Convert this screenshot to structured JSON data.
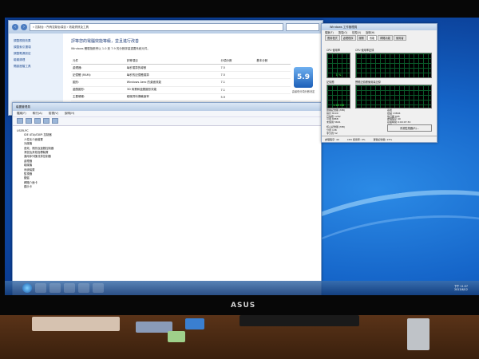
{
  "control_panel": {
    "address": "« 控制台 › 所有控制台項目 › 效能資訊及工具",
    "side_links": [
      "調整視覺效果",
      "調整索引選項",
      "調整電源設定",
      "磁碟清理",
      "開啟進階工具"
    ],
    "heading": "評等您的電腦效能等級，並且進行改善",
    "subtitle": "Windows 體驗指數會以 1.0 到 7.9 的分數評量重要系統元件。",
    "columns": [
      "元件",
      "評等項目",
      "分項分數",
      "基本分數"
    ],
    "rows": [
      {
        "component": "處理器:",
        "description": "每秒運算的導數",
        "score": "7.5"
      },
      {
        "component": "記憶體 (RAM):",
        "description": "每秒的記憶體運算",
        "score": "7.5"
      },
      {
        "component": "圖形:",
        "description": "Windows Aero 的桌面效能",
        "score": "7.1"
      },
      {
        "component": "遊戲圖形:",
        "description": "3D 商業和遊戲圖形效能",
        "score": "7.1"
      },
      {
        "component": "主要硬碟:",
        "description": "磁碟資料傳輸速率",
        "score": "5.9"
      }
    ],
    "base_score": "5.9",
    "base_caption": "由最低分項分數決定"
  },
  "device_manager": {
    "title": "裝置管理員",
    "menu": [
      "檔案(F)",
      "執行(A)",
      "檢視(V)",
      "說明(H)"
    ],
    "tree": [
      {
        "label": "USER-PC",
        "level": 0
      },
      {
        "label": "IDE ATA/ATAPI 控制器",
        "level": 1
      },
      {
        "label": "人性化介面裝置",
        "level": 1
      },
      {
        "label": "光碟機",
        "level": 1
      },
      {
        "label": "音效、視訊及遊戲控制器",
        "level": 1
      },
      {
        "label": "滑鼠及其他指標裝置",
        "level": 1
      },
      {
        "label": "通用序列匯流排控制器",
        "level": 1
      },
      {
        "label": "處理器",
        "level": 1
      },
      {
        "label": "磁碟機",
        "level": 1
      },
      {
        "label": "系統裝置",
        "level": 1
      },
      {
        "label": "監視器",
        "level": 1
      },
      {
        "label": "鍵盤",
        "level": 1
      },
      {
        "label": "網路介面卡",
        "level": 1
      },
      {
        "label": "顯示卡",
        "level": 1
      }
    ]
  },
  "task_manager": {
    "title": "Windows 工作管理員",
    "menu": [
      "檔案(F)",
      "選項(O)",
      "檢視(V)",
      "說明(H)"
    ],
    "tabs": [
      "應用程式",
      "處理程序",
      "服務",
      "效能",
      "網路功能",
      "使用者"
    ],
    "active_tab": "效能",
    "cpu_label": "CPU 使用率",
    "cpu_history_label": "CPU 使用率記錄",
    "cpu_value": "1 %",
    "mem_label": "記憶體",
    "mem_history_label": "實體記憶體使用量記錄",
    "mem_value": "1.28 GB",
    "physical_title": "實體記憶體 (MB)",
    "physical": [
      [
        "總計",
        "8190"
      ],
      [
        "已快取",
        "1282"
      ],
      [
        "可用",
        "6888"
      ],
      [
        "未使用",
        "5691"
      ]
    ],
    "system_title": "系統",
    "system": [
      [
        "控點",
        "13894"
      ],
      [
        "執行緒",
        "605"
      ],
      [
        "處理程序",
        "40"
      ],
      [
        "存留時間",
        "0:00:07:30"
      ],
      [
        "認可 (GB)",
        "1 / 15"
      ]
    ],
    "kernel_title": "核心記憶體 (MB)",
    "kernel": [
      [
        "分頁",
        "138"
      ],
      [
        "非分頁",
        "52"
      ]
    ],
    "resource_button": "資源監視器(R)...",
    "status_processes": "處理程序: 40",
    "status_cpu": "CPU 使用率: 0%",
    "status_memory": "實體記憶體: 15%"
  },
  "taskbar": {
    "time": "下午 11:57",
    "date": "2013/6/12"
  },
  "monitor_logo": "ASUS"
}
